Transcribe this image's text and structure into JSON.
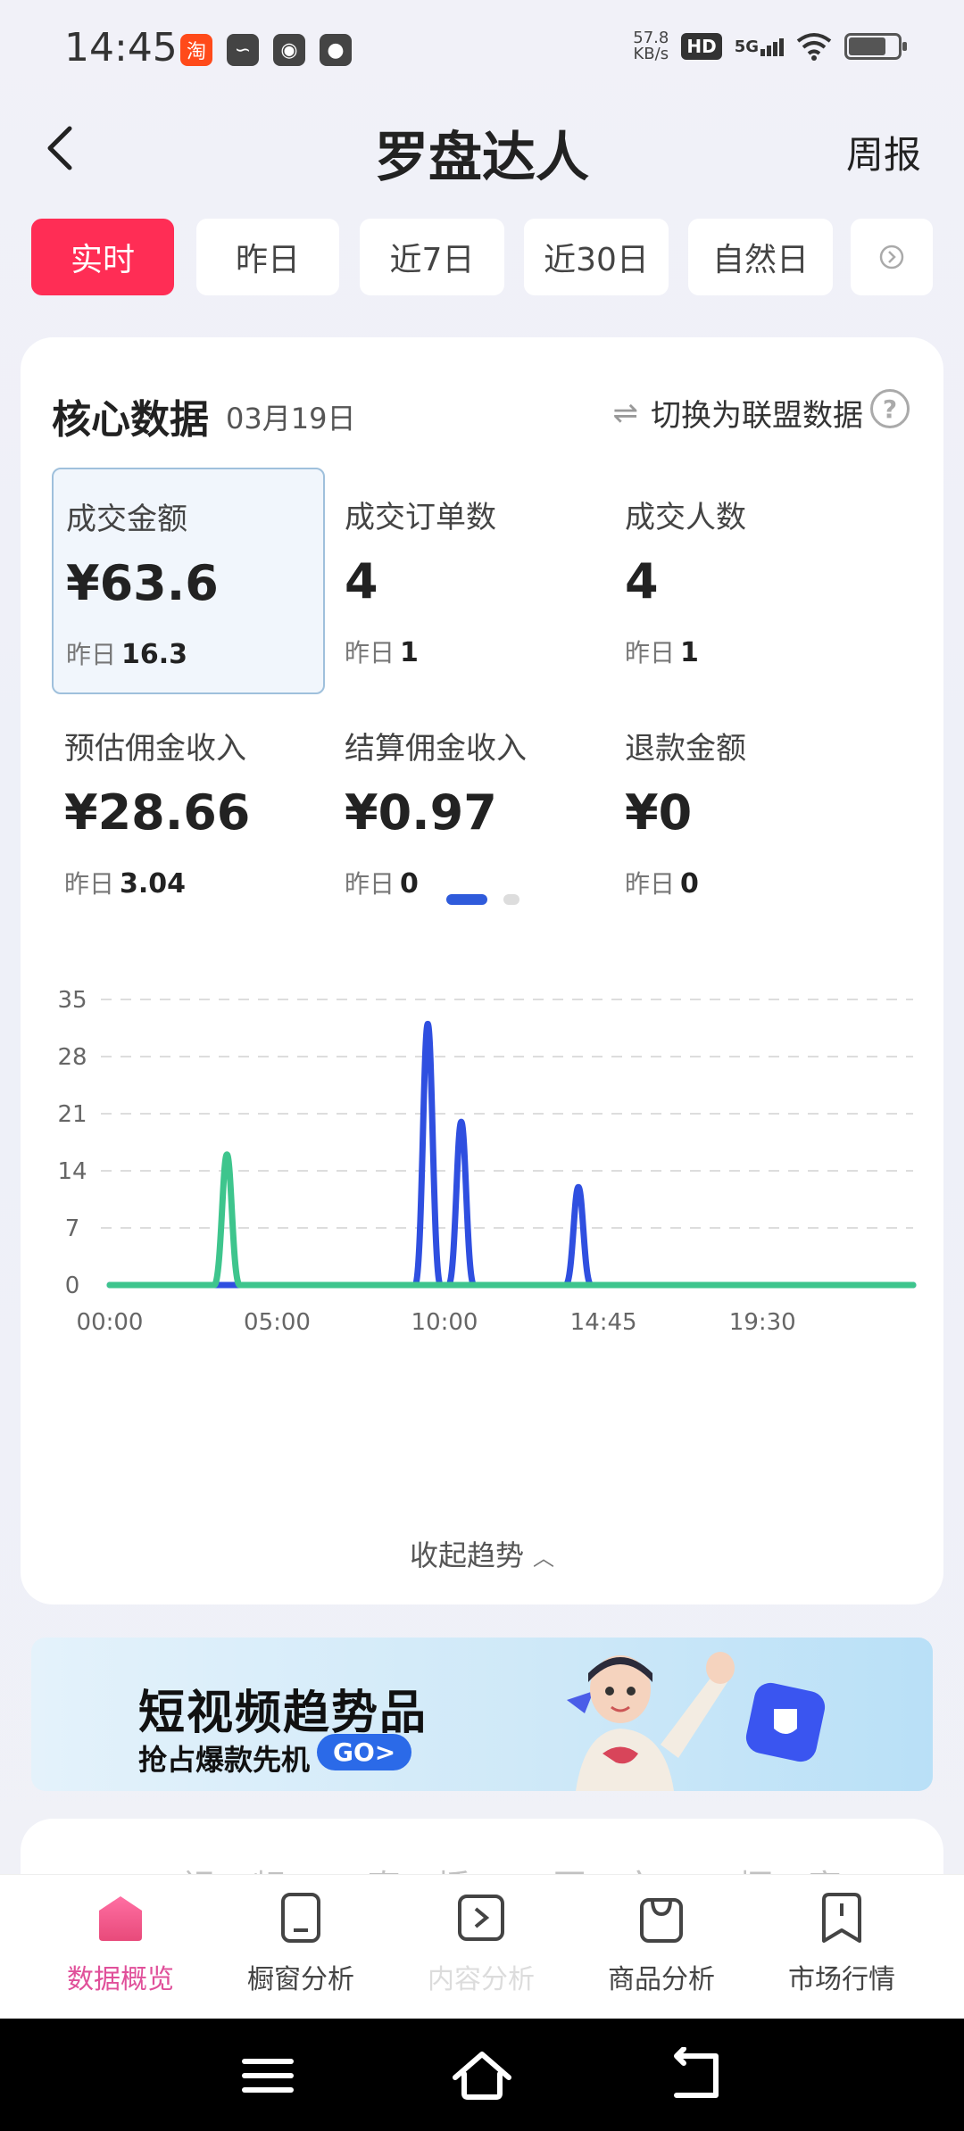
{
  "status_bar": {
    "time": "14:45",
    "net_speed_value": "57.8",
    "net_speed_unit": "KB/s",
    "hd": "HD",
    "network": "5G",
    "left_icons": [
      "taobao-icon",
      "leaf-app-icon",
      "wechat-icon",
      "message-icon"
    ]
  },
  "header": {
    "title": "罗盘达人",
    "right_link": "周报"
  },
  "time_tabs": [
    {
      "label": "实时",
      "active": true
    },
    {
      "label": "昨日",
      "active": false
    },
    {
      "label": "近7日",
      "active": false
    },
    {
      "label": "近30日",
      "active": false
    },
    {
      "label": "自然日",
      "active": false
    }
  ],
  "core": {
    "title": "核心数据",
    "date": "03月19日",
    "switch_label": "切换为联盟数据",
    "help": "?",
    "yesterday_label": "昨日",
    "metrics": [
      {
        "label": "成交金额",
        "value": "¥63.6",
        "yesterday": "16.3",
        "selected": true
      },
      {
        "label": "成交订单数",
        "value": "4",
        "yesterday": "1",
        "selected": false
      },
      {
        "label": "成交人数",
        "value": "4",
        "yesterday": "1",
        "selected": false
      },
      {
        "label": "预估佣金收入",
        "value": "¥28.66",
        "yesterday": "3.04",
        "selected": false
      },
      {
        "label": "结算佣金收入",
        "value": "¥0.97",
        "yesterday": "0",
        "selected": false
      },
      {
        "label": "退款金额",
        "value": "¥0",
        "yesterday": "0",
        "selected": false
      }
    ],
    "pager": {
      "pages": 2,
      "current": 1
    },
    "toggle_label": "收起趋势"
  },
  "chart_data": {
    "type": "line",
    "x_ticks": [
      "00:00",
      "05:00",
      "10:00",
      "14:45",
      "19:30"
    ],
    "x_tick_hours": [
      0,
      5,
      10,
      14.75,
      19.5
    ],
    "x_range_hours": [
      0,
      24
    ],
    "y_ticks": [
      0,
      7,
      14,
      21,
      28,
      35
    ],
    "ylim": [
      0,
      35
    ],
    "grid": true,
    "series": [
      {
        "color": "#2f4fe0",
        "peaks": [
          {
            "hour": 9.5,
            "value": 32
          },
          {
            "hour": 10.5,
            "value": 20
          },
          {
            "hour": 14.0,
            "value": 12
          }
        ]
      },
      {
        "color": "#3ec58d",
        "peaks": [
          {
            "hour": 3.5,
            "value": 16
          }
        ]
      }
    ]
  },
  "banner": {
    "title": "短视频趋势品",
    "subtitle": "抢占爆款先机",
    "go": "GO>"
  },
  "next_card": {
    "tabs_faint": "视频 直播 图文 橱窗"
  },
  "bottom_nav": [
    {
      "label": "数据概览",
      "icon": "home-cube-icon",
      "active": true
    },
    {
      "label": "橱窗分析",
      "icon": "phone-window-icon",
      "active": false
    },
    {
      "label": "内容分析",
      "icon": "play-box-icon",
      "active": false
    },
    {
      "label": "商品分析",
      "icon": "shopping-bag-icon",
      "active": false
    },
    {
      "label": "市场行情",
      "icon": "bookmark-icon",
      "active": false
    }
  ],
  "colors": {
    "accent_pink": "#ff2d55",
    "line_blue": "#2f4fe0",
    "line_green": "#3ec58d",
    "nav_active": "#e0509a"
  }
}
